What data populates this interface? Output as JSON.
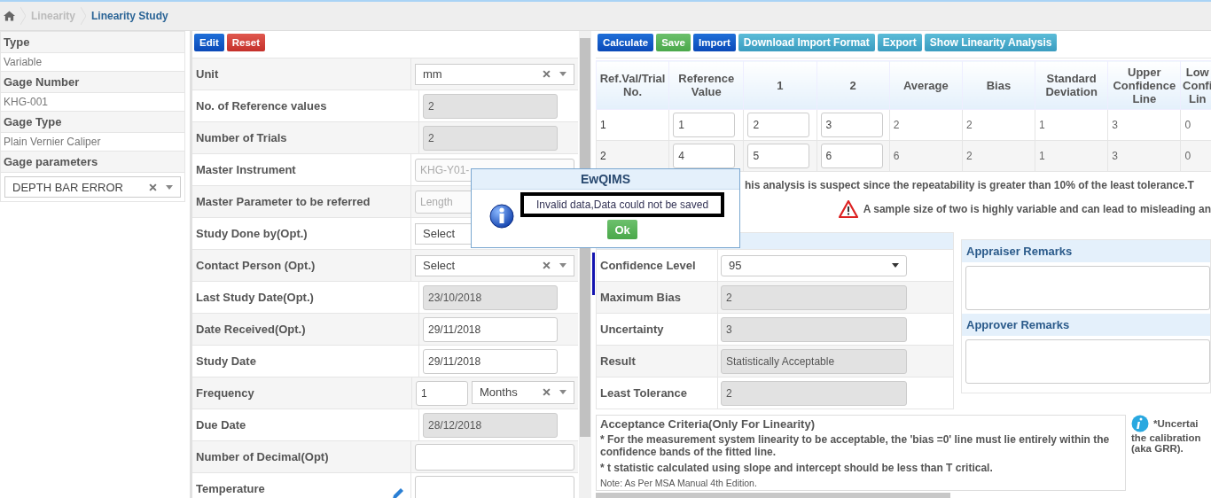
{
  "breadcrumb": [
    {
      "label": "Linearity",
      "current": false
    },
    {
      "label": "Linearity Study",
      "current": true
    }
  ],
  "gage_info": [
    {
      "kind": "text",
      "label": "Type",
      "value": "Variable"
    },
    {
      "kind": "text",
      "label": "Gage Number",
      "value": "KHG-001"
    },
    {
      "kind": "text",
      "label": "Gage Type",
      "value": "Plain Vernier Caliper"
    },
    {
      "kind": "select",
      "label": "Gage parameters",
      "value": "DEPTH BAR ERROR"
    }
  ],
  "form_buttons": [
    {
      "label": "Edit",
      "kind": "primary"
    },
    {
      "label": "Reset",
      "kind": "danger"
    }
  ],
  "form": [
    {
      "kind": "select",
      "label": "Unit",
      "value": "mm",
      "clearable": true
    },
    {
      "kind": "readonly",
      "label": "No. of Reference values",
      "value": "2"
    },
    {
      "kind": "readonly",
      "label": "Number of Trials",
      "value": "2"
    },
    {
      "kind": "disabled",
      "label": "Master Instrument",
      "value": "KHG-Y01-"
    },
    {
      "kind": "disabled",
      "label": "Master Parameter to be referred",
      "value": "Length"
    },
    {
      "kind": "select",
      "label": "Study Done by(Opt.)",
      "value": "Select"
    },
    {
      "kind": "select",
      "label": "Contact Person (Opt.)",
      "value": "Select",
      "clearable": true
    },
    {
      "kind": "readonly",
      "label": "Last Study Date(Opt.)",
      "value": "23/10/2018"
    },
    {
      "kind": "input",
      "label": "Date Received(Opt.)",
      "value": "29/11/2018"
    },
    {
      "kind": "input",
      "label": "Study Date",
      "value": "29/11/2018"
    },
    {
      "kind": "frequency",
      "label": "Frequency",
      "value": "1",
      "unit": "Months"
    },
    {
      "kind": "readonly",
      "label": "Due Date",
      "value": "28/12/2018"
    },
    {
      "kind": "wide",
      "label": "Number of Decimal(Opt)"
    },
    {
      "kind": "note",
      "label": "Temperature"
    }
  ],
  "toolbar": [
    {
      "label": "Calculate",
      "kind": "primary"
    },
    {
      "label": "Save",
      "kind": "success"
    },
    {
      "label": "Import",
      "kind": "primary"
    },
    {
      "label": "Download Import Format",
      "kind": "info"
    },
    {
      "label": "Export",
      "kind": "info"
    },
    {
      "label": "Show Linearity Analysis",
      "kind": "info"
    }
  ],
  "table": {
    "columns": [
      "Ref.Val/Trial No.",
      "Reference Value",
      "1",
      "2",
      "Average",
      "Bias",
      "Standard Deviation",
      "Upper Confidence Line",
      "Low Confi Lin"
    ],
    "rows": [
      [
        "1",
        "1",
        "2",
        "3",
        "2",
        "2",
        "1",
        "3",
        "0"
      ],
      [
        "2",
        "4",
        "5",
        "6",
        "6",
        "2",
        "1",
        "3",
        "0"
      ]
    ]
  },
  "warnings": [
    {
      "kind": "text",
      "text": "his analysis is suspect since the repeatability is greater than 10% of the least tolerance.T"
    },
    {
      "kind": "alert",
      "text": "A sample size of two is highly variable and can lead to misleading an"
    }
  ],
  "results": [
    {
      "kind": "select",
      "label": "Confidence Level",
      "value": "95"
    },
    {
      "kind": "readonly",
      "label": "Maximum Bias",
      "value": "2"
    },
    {
      "kind": "readonly",
      "label": "Uncertainty",
      "value": "3"
    },
    {
      "kind": "readonly",
      "label": "Result",
      "value": "Statistically Acceptable"
    },
    {
      "kind": "readonly",
      "label": "Least Tolerance",
      "value": "2"
    }
  ],
  "remarks": [
    "Appraiser Remarks",
    "Approver Remarks"
  ],
  "acceptance": {
    "title": "Acceptance Criteria(Only For Linearity)",
    "points": [
      "* For the measurement system linearity to be acceptable, the 'bias =0' line must lie entirely within the confidence bands of the fitted line.",
      "* t statistic calculated using slope and intercept should be less than T critical."
    ],
    "note": "Note: As Per MSA Manual 4th Edition."
  },
  "uncertainty_note": {
    "title": "*Uncertai",
    "lines": [
      "the calibration",
      "(aka GRR)."
    ]
  },
  "dialog": {
    "title": "EwQIMS",
    "message": "Invalid data,Data could not be saved",
    "button": "Ok"
  }
}
